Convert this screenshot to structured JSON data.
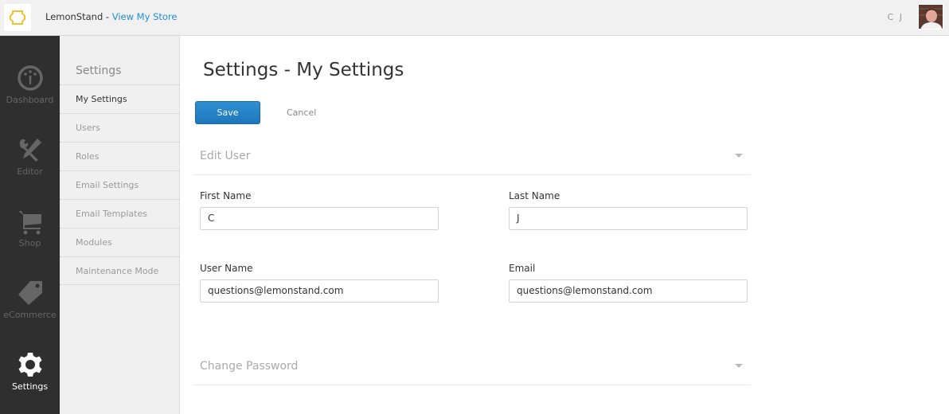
{
  "topbar": {
    "brand": "LemonStand",
    "separator": " - ",
    "store_link": "View My Store",
    "user_initials": "C J",
    "logo_color": "#f2c230"
  },
  "leftnav": {
    "items": [
      {
        "label": "Dashboard",
        "icon": "dashboard-gauge-icon",
        "active": false
      },
      {
        "label": "Editor",
        "icon": "tools-icon",
        "active": false
      },
      {
        "label": "Shop",
        "icon": "shopping-cart-icon",
        "active": false
      },
      {
        "label": "eCommerce",
        "icon": "price-tag-icon",
        "active": false
      },
      {
        "label": "Settings",
        "icon": "gear-icon",
        "active": true
      }
    ]
  },
  "subnav": {
    "title": "Settings",
    "items": [
      {
        "label": "My Settings",
        "active": true
      },
      {
        "label": "Users",
        "active": false
      },
      {
        "label": "Roles",
        "active": false
      },
      {
        "label": "Email Settings",
        "active": false
      },
      {
        "label": "Email Templates",
        "active": false
      },
      {
        "label": "Modules",
        "active": false
      },
      {
        "label": "Maintenance Mode",
        "active": false
      }
    ]
  },
  "main": {
    "title": "Settings - My Settings",
    "save_label": "Save",
    "cancel_label": "Cancel",
    "edit_user": {
      "title": "Edit User",
      "fields": {
        "first_name": {
          "label": "First Name",
          "value": "C"
        },
        "last_name": {
          "label": "Last Name",
          "value": "J"
        },
        "user_name": {
          "label": "User Name",
          "value": "questions@lemonstand.com"
        },
        "email": {
          "label": "Email",
          "value": "questions@lemonstand.com"
        }
      }
    },
    "change_password": {
      "title": "Change Password"
    }
  }
}
